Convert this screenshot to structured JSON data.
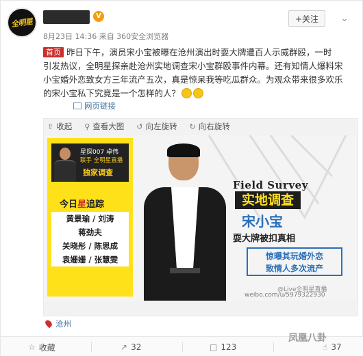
{
  "header": {
    "avatar_text": "全明星",
    "meta": "8月23日 14:36 来自 360安全浏览器",
    "follow_label": "+关注",
    "more_icon": "chevron-down-icon"
  },
  "post": {
    "tag": "首页",
    "text_line_1": "昨日下午，演员宋小宝被曝在沧州演出时耍大牌遭百人示威群殴，一时",
    "text_line_2": "引发热议，全明星探亲赴沧州实地调查宋小宝群殴事件内幕。还有知情人爆料宋",
    "text_line_3": "小宝婚外恋致女方三年流产五次，真是惊呆我等吃瓜群众。为观众带来很多欢乐",
    "text_line_4": "的宋小宝私下究竟是一个怎样的人？",
    "link_label": "网页链接"
  },
  "media_tools": {
    "collapse": "收起",
    "view_large": "查看大图",
    "rotate_left": "向左旋转",
    "rotate_right": "向右旋转"
  },
  "poster": {
    "brand_line_1": "星探007 卓伟",
    "brand_line_2": "联手 全明星直播",
    "brand_line_3": "独家调查",
    "today_prefix": "今日",
    "today_highlight": "星",
    "today_suffix": "追踪",
    "names": [
      "黄景瑜 / 刘涛",
      "蒋劲夫",
      "关晓彤 / 陈思成",
      "袁姗姗 / 张慧雯"
    ],
    "field_survey": "Field Survey",
    "title": "实地调查",
    "subject": "宋小宝",
    "headline": "耍大牌被扣真相",
    "claim_1": "惊曝其玩婚外恋",
    "claim_2": "致情人多次流产",
    "watermark_1": "@Live全明星直播",
    "watermark_2": "weibo.com/u/5979322930"
  },
  "location": "沧州",
  "footer": {
    "collect": "收藏",
    "forward_count": "32",
    "comment_count": "123",
    "like_count": "37",
    "watermark": "凤凰八卦"
  }
}
